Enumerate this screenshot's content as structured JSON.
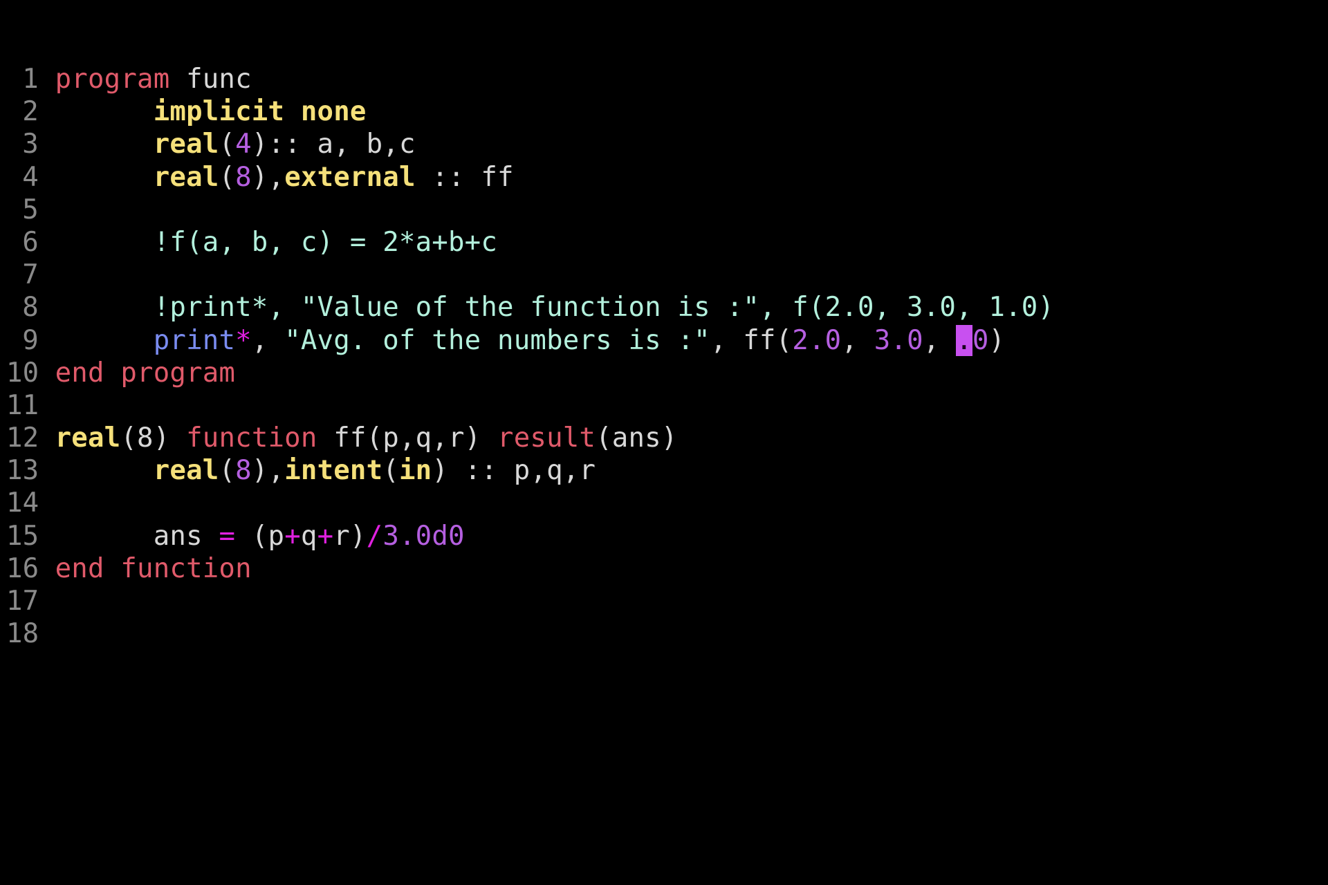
{
  "editor": {
    "language": "fortran",
    "cursor": {
      "line": 9,
      "column": 35
    },
    "colors": {
      "background": "#000000",
      "line_number": "#8a8a8a",
      "plain": "#d8d8d8",
      "keyword": "#e05a6a",
      "type": "#f5e07a",
      "number": "#b55fe0",
      "operator": "#e020e0",
      "comment": "#b3f0dc",
      "string": "#b3f0dc",
      "io": "#7a8cf0",
      "cursor": "#c850f0"
    },
    "lines": [
      {
        "number": "1",
        "tokens": [
          [
            "program",
            "kw"
          ],
          [
            " func",
            "plain"
          ]
        ]
      },
      {
        "number": "2",
        "tokens": [
          [
            "      ",
            "plain"
          ],
          [
            "implicit none",
            "type"
          ]
        ]
      },
      {
        "number": "3",
        "tokens": [
          [
            "      ",
            "plain"
          ],
          [
            "real",
            "type"
          ],
          [
            "(",
            "plain"
          ],
          [
            "4",
            "num"
          ],
          [
            ")::",
            "plain"
          ],
          [
            " a, b,c",
            "plain"
          ]
        ]
      },
      {
        "number": "4",
        "tokens": [
          [
            "      ",
            "plain"
          ],
          [
            "real",
            "type"
          ],
          [
            "(",
            "plain"
          ],
          [
            "8",
            "num"
          ],
          [
            "),",
            "plain"
          ],
          [
            "external",
            "type"
          ],
          [
            " :: ff",
            "plain"
          ]
        ]
      },
      {
        "number": "5",
        "tokens": []
      },
      {
        "number": "6",
        "tokens": [
          [
            "      ",
            "plain"
          ],
          [
            "!f(a, b, c) = 2*a+b+c",
            "comment"
          ]
        ]
      },
      {
        "number": "7",
        "tokens": []
      },
      {
        "number": "8",
        "tokens": [
          [
            "      ",
            "plain"
          ],
          [
            "!print*, \"Value of the function is :\", f(2.0, 3.0, 1.0)",
            "comment"
          ]
        ]
      },
      {
        "number": "9",
        "tokens": [
          [
            "      ",
            "plain"
          ],
          [
            "print",
            "io"
          ],
          [
            "*",
            "op"
          ],
          [
            ", ",
            "plain"
          ],
          [
            "\"Avg. of the numbers is :\"",
            "string"
          ],
          [
            ", ff(",
            "plain"
          ],
          [
            "2.0",
            "num"
          ],
          [
            ", ",
            "plain"
          ],
          [
            "3.0",
            "num"
          ],
          [
            ", ",
            "plain"
          ],
          [
            ".",
            "cursor"
          ],
          [
            "0",
            "num"
          ],
          [
            ")",
            "plain"
          ]
        ]
      },
      {
        "number": "10",
        "tokens": [
          [
            "end program",
            "kw"
          ]
        ]
      },
      {
        "number": "11",
        "tokens": []
      },
      {
        "number": "12",
        "tokens": [
          [
            "real",
            "type"
          ],
          [
            "(8) ",
            "plain"
          ],
          [
            "function",
            "kw"
          ],
          [
            " ff(p,q,r) ",
            "plain"
          ],
          [
            "result",
            "kw"
          ],
          [
            "(ans)",
            "plain"
          ]
        ]
      },
      {
        "number": "13",
        "tokens": [
          [
            "      ",
            "plain"
          ],
          [
            "real",
            "type"
          ],
          [
            "(",
            "plain"
          ],
          [
            "8",
            "num"
          ],
          [
            "),",
            "plain"
          ],
          [
            "intent",
            "type"
          ],
          [
            "(",
            "plain"
          ],
          [
            "in",
            "type"
          ],
          [
            ") :: p,q,r",
            "plain"
          ]
        ]
      },
      {
        "number": "14",
        "tokens": []
      },
      {
        "number": "15",
        "tokens": [
          [
            "      ",
            "plain"
          ],
          [
            "ans ",
            "plain"
          ],
          [
            "=",
            "op"
          ],
          [
            " (p",
            "plain"
          ],
          [
            "+",
            "op"
          ],
          [
            "q",
            "plain"
          ],
          [
            "+",
            "op"
          ],
          [
            "r)",
            "plain"
          ],
          [
            "/",
            "op"
          ],
          [
            "3.0d0",
            "num"
          ]
        ]
      },
      {
        "number": "16",
        "tokens": [
          [
            "end function",
            "kw"
          ]
        ]
      },
      {
        "number": "17",
        "tokens": []
      },
      {
        "number": "18",
        "tokens": []
      }
    ]
  }
}
